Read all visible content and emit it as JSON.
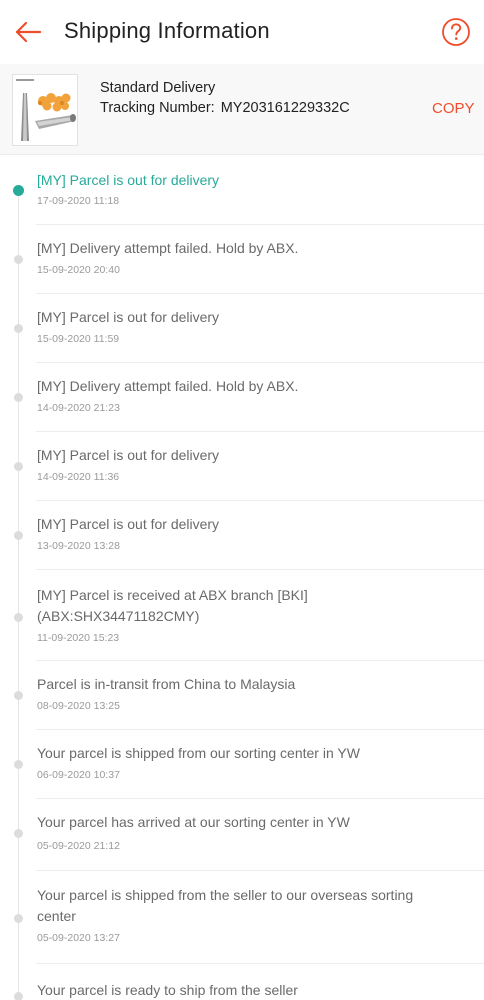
{
  "header": {
    "title": "Shipping Information",
    "back_icon": "arrow-left-icon",
    "help_icon": "question-circle-icon",
    "accent_color": "#ee4d2d"
  },
  "package": {
    "delivery_type": "Standard Delivery",
    "tracking_label": "Tracking Number:",
    "tracking_number": "MY203161229332C",
    "copy_label": "COPY"
  },
  "timeline": {
    "active_color": "#26aa99",
    "events": [
      {
        "text": "[MY] Parcel is out for delivery",
        "time": "17-09-2020 11:18"
      },
      {
        "text": "[MY] Delivery attempt failed. Hold by ABX.",
        "time": "15-09-2020 20:40"
      },
      {
        "text": "[MY] Parcel is out for delivery",
        "time": "15-09-2020 11:59"
      },
      {
        "text": "[MY] Delivery attempt failed. Hold by ABX.",
        "time": "14-09-2020 21:23"
      },
      {
        "text": "[MY] Parcel is out for delivery",
        "time": "14-09-2020 11:36"
      },
      {
        "text": "[MY] Parcel is out for delivery",
        "time": "13-09-2020 13:28"
      },
      {
        "text": "[MY] Parcel is received at ABX branch [BKI] (ABX:SHX34471182CMY)",
        "time": "11-09-2020 15:23"
      },
      {
        "text": "Parcel is in-transit from China to Malaysia",
        "time": "08-09-2020 13:25"
      },
      {
        "text": "Your parcel is shipped from our sorting center in YW",
        "time": "06-09-2020 10:37"
      },
      {
        "text": "Your parcel has arrived at our sorting center in YW",
        "time": "05-09-2020 21:12"
      },
      {
        "text": "Your parcel is shipped from the seller to our overseas sorting center",
        "time": "05-09-2020 13:27"
      },
      {
        "text": "Your parcel is ready to ship from the seller",
        "time": ""
      }
    ]
  }
}
